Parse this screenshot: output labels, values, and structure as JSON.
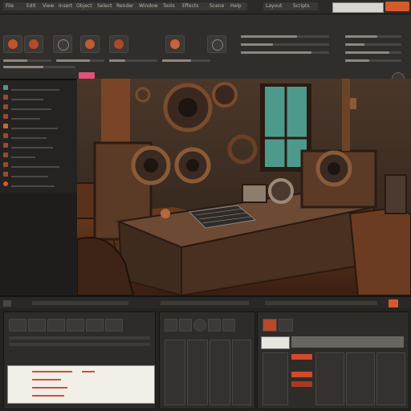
{
  "menubar": {
    "items": [
      "File",
      "Edit",
      "View",
      "Insert",
      "Object",
      "Select",
      "Render",
      "Window",
      "Tools",
      "Effects",
      "Scene",
      "Help",
      "Layout",
      "Scripts"
    ]
  },
  "search": {
    "placeholder": ""
  },
  "toolbar": {
    "tool_icons": [
      "brush-icon",
      "camera-icon",
      "light-icon",
      "material-icon",
      "node-icon",
      "transform-icon",
      "bone-icon"
    ]
  },
  "left_panel": {
    "rows": [
      "",
      "",
      "",
      "",
      "",
      "",
      "",
      "",
      "",
      "",
      ""
    ]
  },
  "document": {
    "lines": [
      "",
      "",
      "",
      ""
    ]
  },
  "colors": {
    "accent": "#d65a2a",
    "highlight": "#e1527a",
    "panel": "#2e2c29",
    "teal_window": "#4d9a8c"
  }
}
